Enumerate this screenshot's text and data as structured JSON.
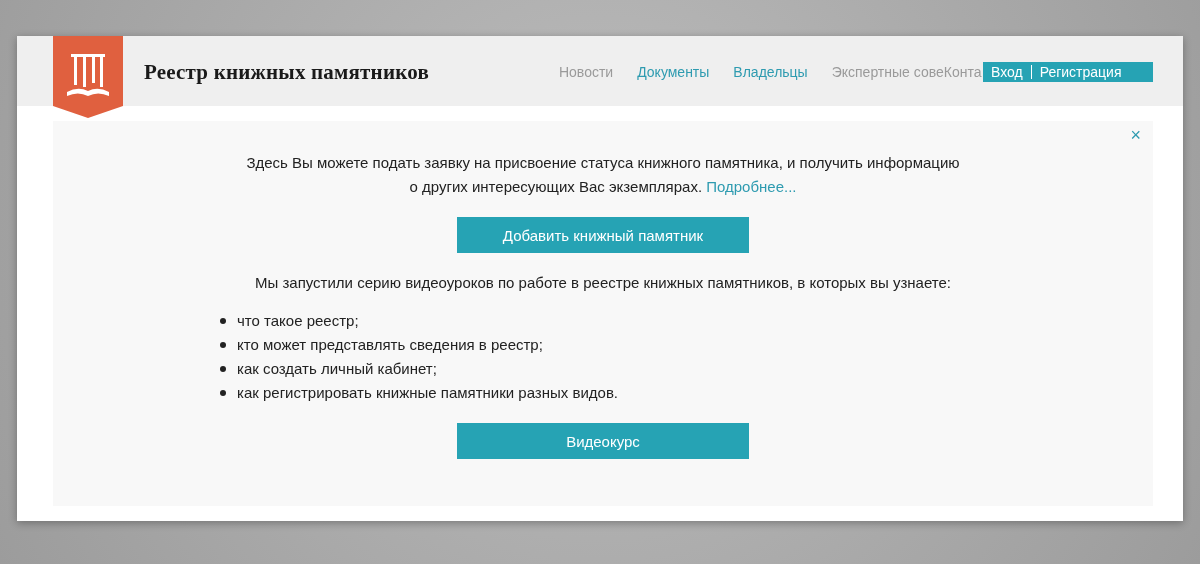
{
  "header": {
    "site_title": "Реестр книжных памятников",
    "nav": [
      {
        "label": "Новости",
        "highlighted": false
      },
      {
        "label": "Документы",
        "highlighted": true
      },
      {
        "label": "Владельцы",
        "highlighted": true
      },
      {
        "label": "Экспертные сове",
        "highlighted": false
      },
      {
        "label": "Конта",
        "highlighted": false
      }
    ],
    "auth": [
      "Вход",
      "Регистрация"
    ]
  },
  "notice": {
    "close": "×",
    "intro": "Здесь Вы можете подать заявку на присвоение статуса книжного памятника, и получить информацию о других интересующих Вас экземплярах.",
    "more_link": "Подробнее...",
    "add_button": "Добавить книжный памятник",
    "video_text": "Мы запустили серию видеоуроков по работе в реестре книжных памятников, в которых вы узнаете:",
    "topics": [
      "что такое реестр;",
      "кто может представлять сведения в реестр;",
      "как создать личный кабинет;",
      "как регистрировать книжные памятники разных видов."
    ],
    "video_button": "Видеокурс"
  }
}
